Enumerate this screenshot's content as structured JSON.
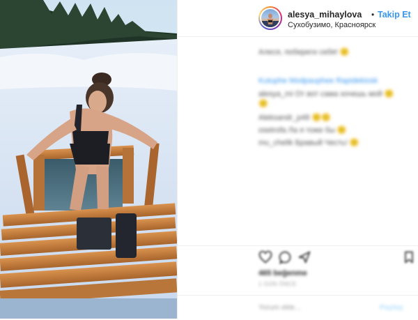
{
  "post": {
    "username": "alesya_mihaylova",
    "separator": "•",
    "follow_label": "Takip Et",
    "location": "Сухобузимо, Красноярск"
  },
  "comments": [
    {
      "text": "Алеся, побереги себя! 🙂"
    },
    {
      "text": "Kutuphe Modpauphee Rapidekiosk",
      "style": "blue"
    },
    {
      "text": "alesya_mi Oт вот сама хочешь мой 🙂"
    },
    {
      "text": "🙂"
    },
    {
      "text": "Aleksandr_p48 🙂🙂"
    },
    {
      "text": "osetrofa Ла я тоже бы 🙂"
    },
    {
      "text": "mu_chelik Бравый Честь! 🙂"
    }
  ],
  "actions": {
    "icons": [
      "heart-icon",
      "comment-icon",
      "share-icon",
      "bookmark-icon"
    ],
    "likes": "465 beğenme",
    "time": "1 GÜN ÖNCE",
    "add_comment_placeholder": "Yorum ekle...",
    "post_label": "Paylaş"
  },
  "colors": {
    "accent": "#3897f0",
    "border": "#efefef",
    "text": "#262626"
  }
}
